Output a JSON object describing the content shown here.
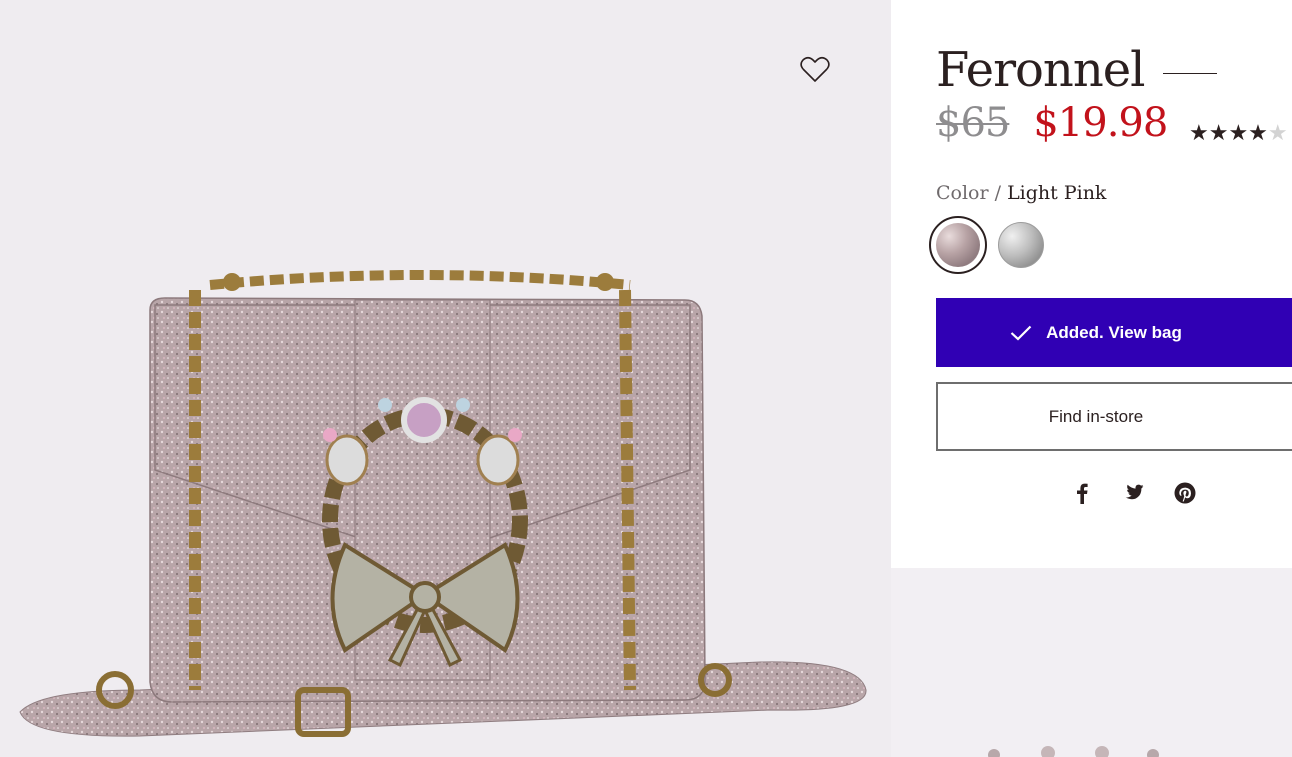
{
  "product": {
    "title": "Feronnel",
    "price_original": "$65",
    "price_sale": "$19.98",
    "rating_stars": 4,
    "rating_max": 5,
    "rating_filled_glyphs": "★★★★",
    "rating_empty_glyphs": "★"
  },
  "color": {
    "label": "Color /",
    "selected": "Light Pink",
    "swatches": [
      {
        "name": "light-pink-glitter",
        "color": "#b8a3a5",
        "selected": true
      },
      {
        "name": "silver-glitter",
        "color": "#bdbdbd",
        "selected": false
      }
    ]
  },
  "actions": {
    "added_label": "Added. View bag",
    "find_store_label": "Find in-store"
  },
  "social": [
    "facebook-icon",
    "twitter-icon",
    "pinterest-icon"
  ],
  "icons": {
    "wishlist": "heart-outline-icon"
  },
  "colors": {
    "accent": "#3000b4",
    "sale": "#c2121b",
    "text": "#2b2020",
    "muted": "#8e8d8f",
    "gallery_bg": "#efecf0"
  }
}
